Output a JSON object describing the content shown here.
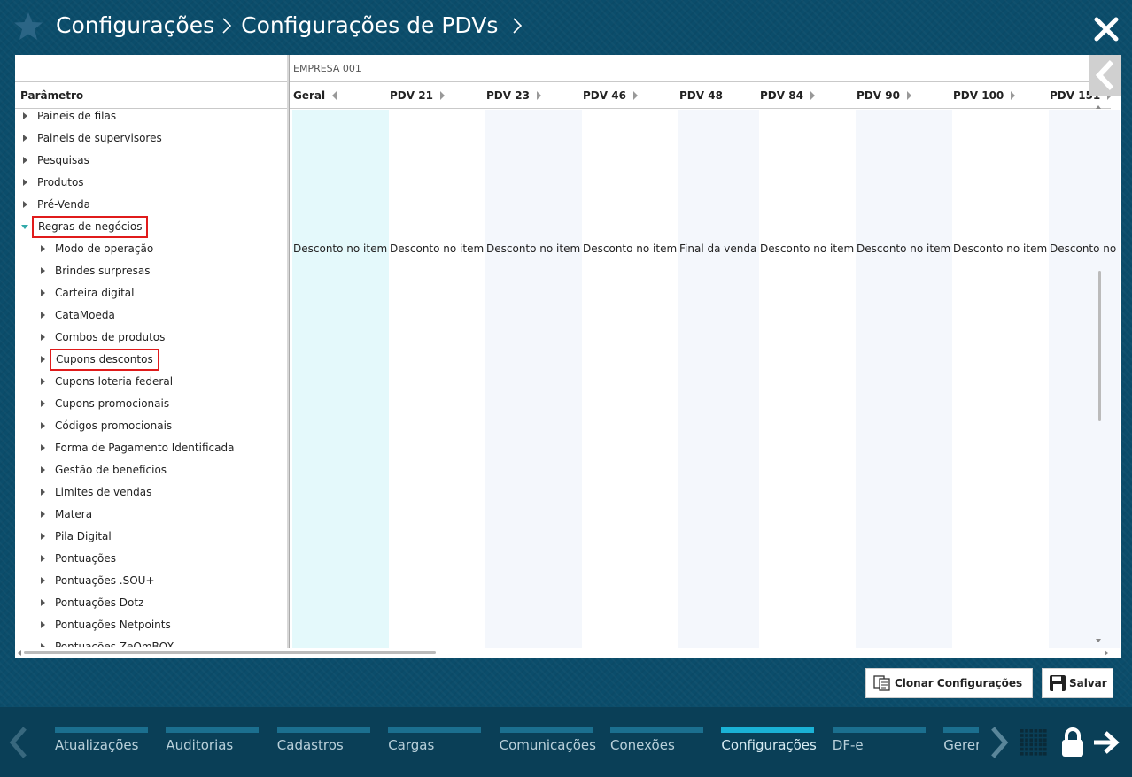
{
  "header": {
    "crumbs": [
      "Configurações",
      "Configurações de PDVs"
    ],
    "close_icon": "close-icon",
    "star_icon": "star-icon"
  },
  "table": {
    "param_header": "Parâmetro",
    "empresa": "EMPRESA 001",
    "columns": [
      {
        "label": "Geral",
        "value": "Desconto no item",
        "arrow": "left"
      },
      {
        "label": "PDV 21",
        "value": "Desconto no item",
        "arrow": "right"
      },
      {
        "label": "PDV 23",
        "value": "Desconto no item",
        "arrow": "right"
      },
      {
        "label": "PDV 46",
        "value": "Desconto no item",
        "arrow": "right"
      },
      {
        "label": "PDV 48",
        "value": "Final da venda",
        "arrow": "none"
      },
      {
        "label": "PDV 84",
        "value": "Desconto no item",
        "arrow": "right"
      },
      {
        "label": "PDV 90",
        "value": "Desconto no item",
        "arrow": "right"
      },
      {
        "label": "PDV 100",
        "value": "Desconto no item",
        "arrow": "right"
      },
      {
        "label": "PDV 151",
        "value": "Desconto no item",
        "arrow": "right"
      }
    ],
    "tree": [
      {
        "label": "Paineis de filas",
        "level": 0,
        "expanded": false,
        "highlight": false
      },
      {
        "label": "Paineis de supervisores",
        "level": 0,
        "expanded": false,
        "highlight": false
      },
      {
        "label": "Pesquisas",
        "level": 0,
        "expanded": false,
        "highlight": false
      },
      {
        "label": "Produtos",
        "level": 0,
        "expanded": false,
        "highlight": false
      },
      {
        "label": "Pré-Venda",
        "level": 0,
        "expanded": false,
        "highlight": false
      },
      {
        "label": "Regras de negócios",
        "level": 0,
        "expanded": true,
        "highlight": true
      },
      {
        "label": "Modo de operação",
        "level": 1,
        "expanded": false,
        "highlight": false
      },
      {
        "label": "Brindes surpresas",
        "level": 1,
        "expanded": false,
        "highlight": false
      },
      {
        "label": "Carteira digital",
        "level": 1,
        "expanded": false,
        "highlight": false
      },
      {
        "label": "CataMoeda",
        "level": 1,
        "expanded": false,
        "highlight": false
      },
      {
        "label": "Combos de produtos",
        "level": 1,
        "expanded": false,
        "highlight": false
      },
      {
        "label": "Cupons descontos",
        "level": 1,
        "expanded": false,
        "highlight": true
      },
      {
        "label": "Cupons loteria federal",
        "level": 1,
        "expanded": false,
        "highlight": false
      },
      {
        "label": "Cupons promocionais",
        "level": 1,
        "expanded": false,
        "highlight": false
      },
      {
        "label": "Códigos promocionais",
        "level": 1,
        "expanded": false,
        "highlight": false
      },
      {
        "label": "Forma de Pagamento Identificada",
        "level": 1,
        "expanded": false,
        "highlight": false
      },
      {
        "label": "Gestão de benefícios",
        "level": 1,
        "expanded": false,
        "highlight": false
      },
      {
        "label": "Limites de vendas",
        "level": 1,
        "expanded": false,
        "highlight": false
      },
      {
        "label": "Matera",
        "level": 1,
        "expanded": false,
        "highlight": false
      },
      {
        "label": "Pila Digital",
        "level": 1,
        "expanded": false,
        "highlight": false
      },
      {
        "label": "Pontuações",
        "level": 1,
        "expanded": false,
        "highlight": false
      },
      {
        "label": "Pontuações .SOU+",
        "level": 1,
        "expanded": false,
        "highlight": false
      },
      {
        "label": "Pontuações Dotz",
        "level": 1,
        "expanded": false,
        "highlight": false
      },
      {
        "label": "Pontuações Netpoints",
        "level": 1,
        "expanded": false,
        "highlight": false
      },
      {
        "label": "Pontuações ZeOmBOX",
        "level": 1,
        "expanded": false,
        "highlight": false
      }
    ]
  },
  "actions": {
    "clone_label": "Clonar Configurações",
    "save_label": "Salvar"
  },
  "bottom_nav": {
    "tabs": [
      "Atualizações",
      "Auditorias",
      "Cadastros",
      "Cargas",
      "Comunicações",
      "Conexões",
      "Configurações",
      "DF-e",
      "Gerenciamento"
    ],
    "active": "Configurações"
  },
  "colors": {
    "background": "#0b4d6b",
    "active_tab_bar": "#1ab2d6",
    "tab_bar": "#1b6f8f",
    "highlight_border": "#e01b1b",
    "column_geral_bg": "#e4f9fb",
    "column_alt_bg": "#f4f7fc"
  }
}
